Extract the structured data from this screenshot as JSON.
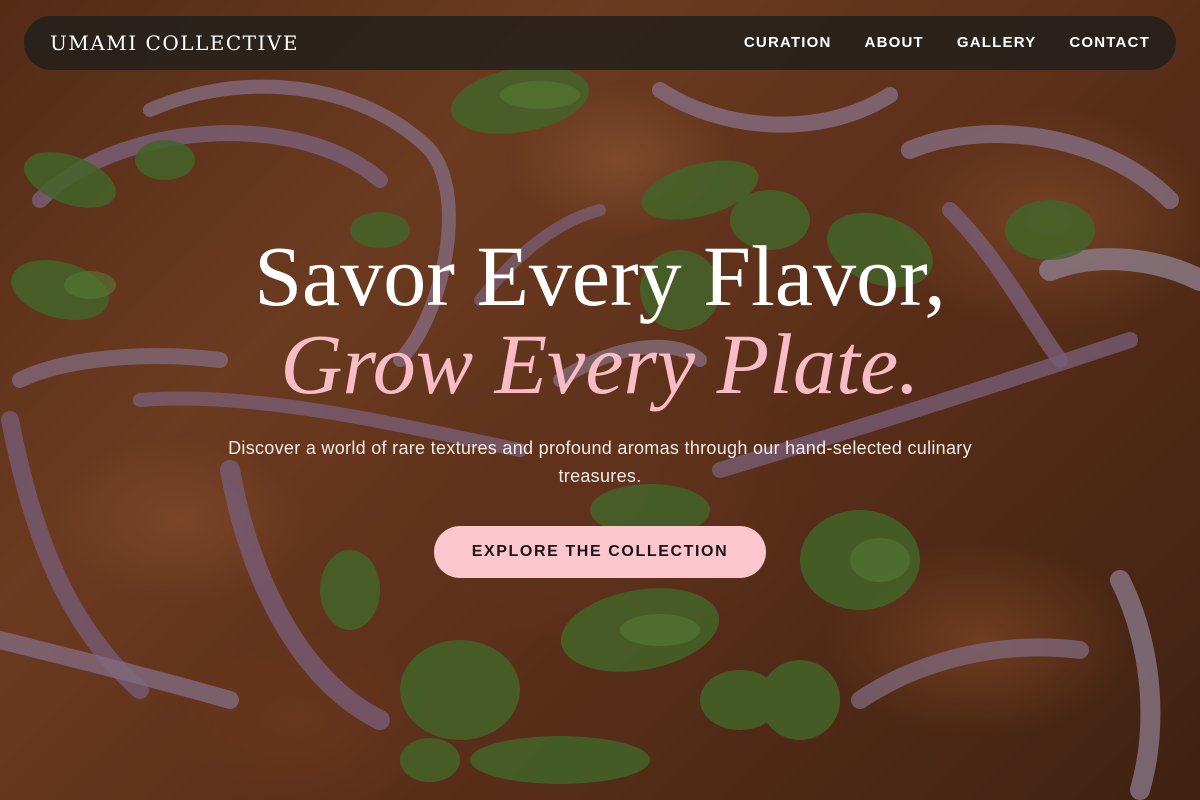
{
  "header": {
    "brand": "UMAMI COLLECTIVE",
    "nav": [
      {
        "label": "CURATION"
      },
      {
        "label": "ABOUT"
      },
      {
        "label": "GALLERY"
      },
      {
        "label": "CONTACT"
      }
    ]
  },
  "hero": {
    "headline_line1": "Savor Every Flavor,",
    "headline_line2": "Grow Every Plate.",
    "subtitle": "Discover a world of rare textures and profound aromas through our hand-selected culinary treasures.",
    "cta_label": "EXPLORE THE COLLECTION",
    "background_description_icon": "food-photo-background"
  },
  "colors": {
    "accent_pink": "#fcc6cf",
    "headline_italic": "#f8bcc6",
    "navbar_bg": "#1e1e1e",
    "text_light": "#ffffff"
  }
}
